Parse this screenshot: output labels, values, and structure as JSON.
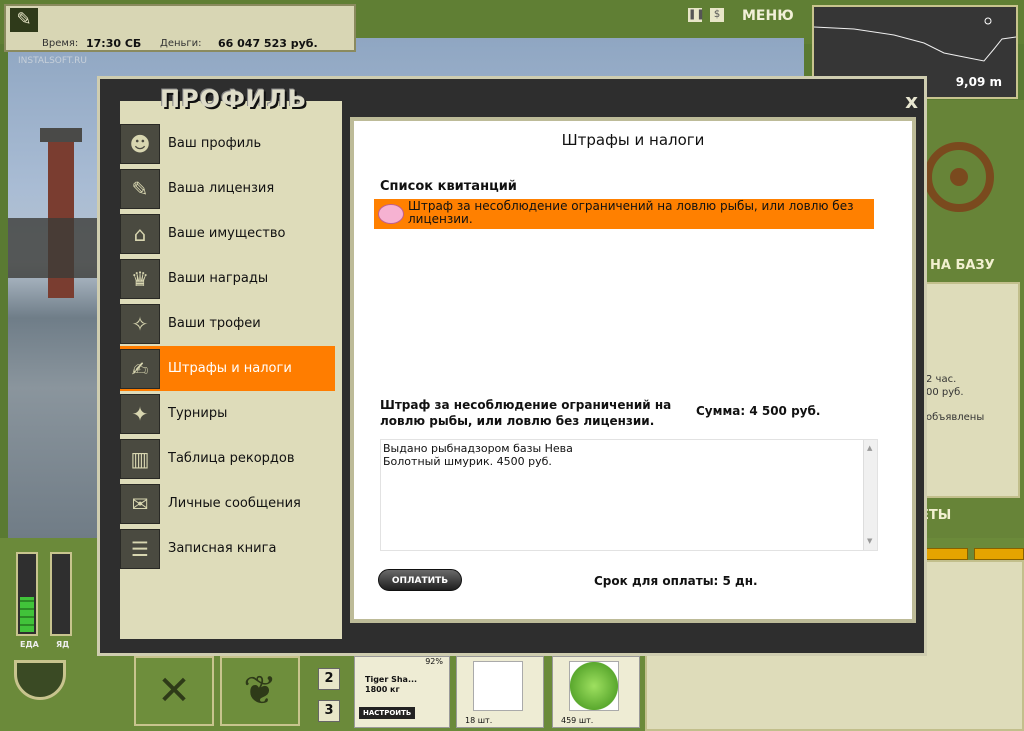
{
  "status": {
    "time_label": "Время:",
    "time_value": "17:30 СБ",
    "money_label": "Деньги:",
    "money_value": "66 047 523 руб."
  },
  "header": {
    "menu_label": "МЕНЮ"
  },
  "depth_panel": {
    "depth_value": "9,09 m"
  },
  "watermark": "INSTALSOFT.RU",
  "right_panel": {
    "to_base_label": "НА БАЗУ",
    "line1": "2 час.",
    "line2": "00 руб.",
    "line3": "объявлены",
    "section_label": "ЕТЫ"
  },
  "bottom_bar": {
    "food_label": "ЕДА",
    "poison_label": "ЯД",
    "food_level": 0.45,
    "poison_level": 0,
    "slot_buttons": [
      "2",
      "3"
    ],
    "tackle": {
      "percent": "92%",
      "name": "Tiger Sha...",
      "weight": "1800 кг",
      "setup_label": "НАСТРОИТЬ"
    },
    "baits": [
      {
        "icon": "lure-icon",
        "count": "18 шт."
      },
      {
        "icon": "cabbage-icon",
        "count": "459 шт."
      }
    ]
  },
  "modal": {
    "title": "ПРОФИЛЬ",
    "close": "x",
    "nav": [
      {
        "label": "Ваш профиль",
        "icon": "people-icon"
      },
      {
        "label": "Ваша лицензия",
        "icon": "license-icon"
      },
      {
        "label": "Ваше имущество",
        "icon": "house-icon"
      },
      {
        "label": "Ваши награды",
        "icon": "trophy-icon"
      },
      {
        "label": "Ваши трофеи",
        "icon": "fish-trophy-icon"
      },
      {
        "label": "Штрафы и налоги",
        "icon": "fine-document-icon"
      },
      {
        "label": "Турниры",
        "icon": "tournament-icon"
      },
      {
        "label": "Таблица рекордов",
        "icon": "chart-icon"
      },
      {
        "label": "Личные сообщения",
        "icon": "envelope-icon"
      },
      {
        "label": "Записная книга",
        "icon": "notebook-icon"
      }
    ],
    "active_index": 5,
    "panel": {
      "heading": "Штрафы и налоги",
      "list_header": "Список квитанций",
      "receipts": [
        {
          "text": "Штраф за несоблюдение ограничений на ловлю рыбы, или ловлю без лицензии.",
          "icon": "piggy-bank-icon"
        }
      ],
      "detail_title": "Штраф за несоблюдение ограничений на ловлю рыбы, или ловлю без лицензии.",
      "sum_label": "Сумма: 4 500 руб.",
      "description_line1": "Выдано рыбнадзором базы Нева",
      "description_line2": "Болотный шмурик. 4500 руб.",
      "pay_button": "ОПЛАТИТЬ",
      "due_label": "Срок для оплаты: 5 дн."
    }
  }
}
